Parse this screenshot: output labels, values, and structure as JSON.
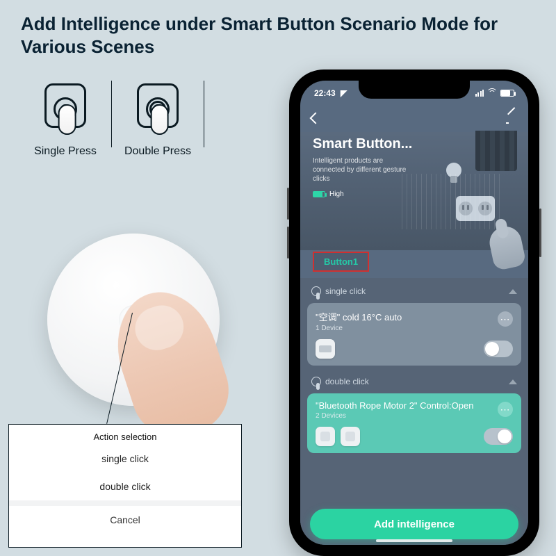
{
  "heading": "Add Intelligence under Smart Button Scenario Mode for Various Scenes",
  "press": {
    "single": "Single Press",
    "double": "Double Press"
  },
  "popup": {
    "title": "Action selection",
    "opt1": "single click",
    "opt2": "double click",
    "cancel": "Cancel"
  },
  "phone": {
    "status": {
      "time": "22:43"
    },
    "hero": {
      "title": "Smart Button...",
      "desc": "Intelligent products are connected by different gesture clicks",
      "battery": "High"
    },
    "tab": "Button1",
    "section1": {
      "label": "single click",
      "card": {
        "title": "\"空调\" cold 16°C auto",
        "sub": "1 Device"
      }
    },
    "section2": {
      "label": "double click",
      "card": {
        "title": "\"Bluetooth Rope Motor 2\" Control:Open",
        "sub": "2 Devices"
      }
    },
    "addBtn": "Add intelligence"
  }
}
